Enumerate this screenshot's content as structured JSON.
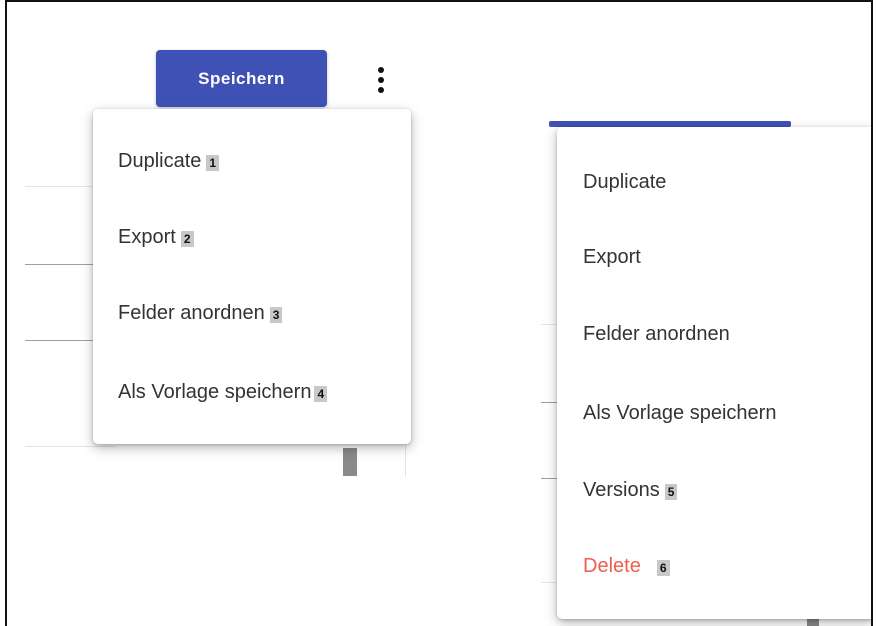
{
  "header": {
    "save_label": "Speichern"
  },
  "menu_left": {
    "items": [
      {
        "label": "Duplicate",
        "badge": "1"
      },
      {
        "label": "Export",
        "badge": "2"
      },
      {
        "label": "Felder anordnen",
        "badge": "3"
      },
      {
        "label": "Als Vorlage speichern",
        "badge": "4"
      }
    ]
  },
  "menu_right": {
    "items": [
      {
        "label": "Duplicate"
      },
      {
        "label": "Export"
      },
      {
        "label": "Felder anordnen"
      },
      {
        "label": "Als Vorlage speichern"
      },
      {
        "label": "Versions",
        "badge": "5"
      },
      {
        "label": "Delete",
        "badge": "6",
        "color": "#f25c4c"
      }
    ]
  },
  "colors": {
    "primary": "#3f51b5",
    "danger": "#f25c4c"
  },
  "icons": {
    "more": "more-vert-icon"
  }
}
